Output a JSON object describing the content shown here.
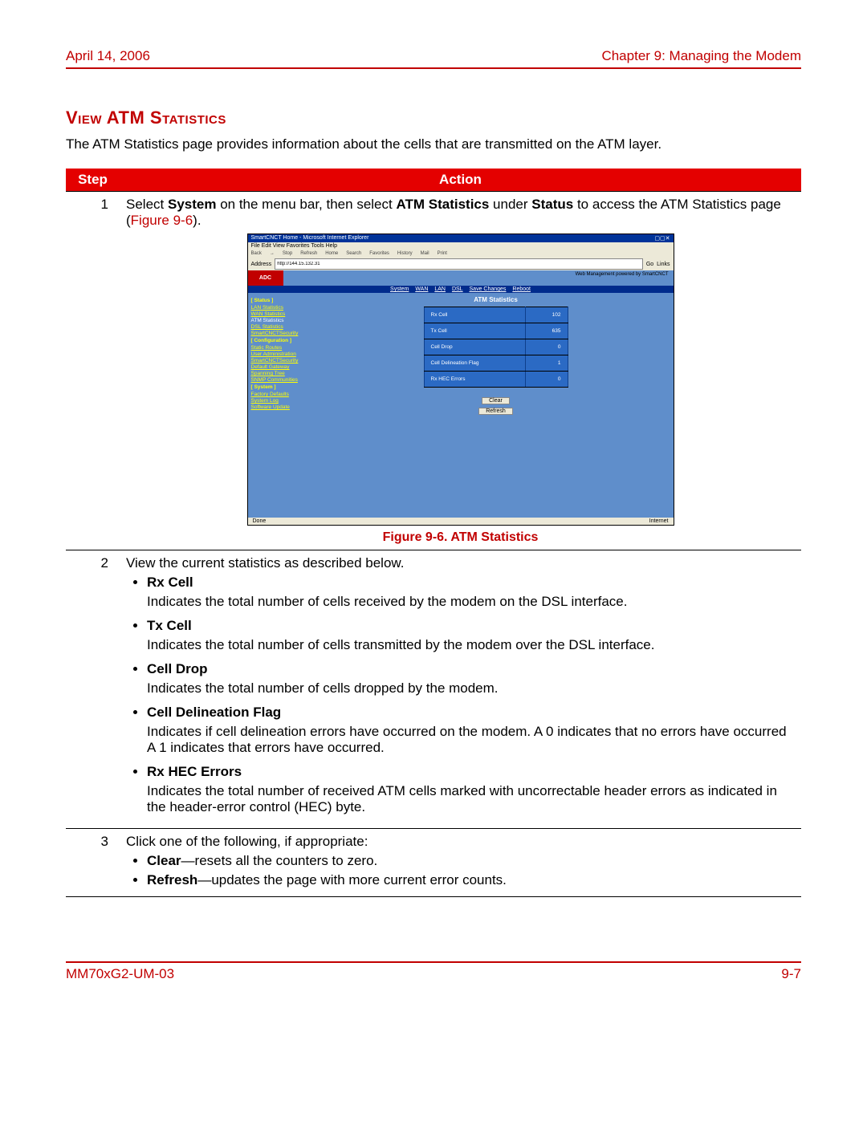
{
  "header": {
    "date": "April 14, 2006",
    "chapter": "Chapter 9: Managing the Modem"
  },
  "section": {
    "title": "View ATM Statistics",
    "intro": "The ATM Statistics page provides information about the cells that are transmitted on the ATM layer."
  },
  "table_head": {
    "step": "Step",
    "action": "Action"
  },
  "step1": {
    "num": "1",
    "a": "Select ",
    "b": "System",
    "c": " on the menu bar, then select ",
    "d": "ATM Statistics",
    "e": " under ",
    "f": "Status",
    "g": " to access the ATM Statistics page (",
    "h": "Figure 9-6",
    "i": ")."
  },
  "figure": {
    "caption": "Figure 9-6. ATM Statistics"
  },
  "screenshot": {
    "window_title": "SmartCNCT Home - Microsoft Internet Explorer",
    "menus": "File  Edit  View  Favorites  Tools  Help",
    "toolbar": [
      "Back",
      "",
      "Stop",
      "Refresh",
      "Home",
      "Search",
      "Favorites",
      "History",
      "Mail",
      "Print"
    ],
    "address_label": "Address",
    "address_value": "http://144.15.132.31",
    "go": "Go",
    "links": "Links",
    "logo": "ADC",
    "web_mgmt": "Web Management powered by SmartCNCT",
    "topnav": [
      "System",
      "WAN",
      "LAN",
      "DSL",
      "Save Changes",
      "Reboot"
    ],
    "sidebar": {
      "status_hdr": "[ Status ]",
      "items1": [
        "LAN Statistics",
        "WAN Statistics",
        "ATM Statistics",
        "DSL Statistics",
        "SmartCNCTSecurity"
      ],
      "config_hdr": "[ Configuration ]",
      "items2": [
        "Static Routes",
        "User Administration",
        "SmartCNCTSecurity",
        "Default Gateway",
        "Spanning Tree",
        "SNMP Communities"
      ],
      "system_hdr": "[ System ]",
      "items3": [
        "Factory Defaults",
        "System Log",
        "Software Update"
      ]
    },
    "main_title": "ATM Statistics",
    "stats": [
      {
        "k": "Rx Cell",
        "v": "102"
      },
      {
        "k": "Tx Cell",
        "v": "635"
      },
      {
        "k": "Cell Drop",
        "v": "0"
      },
      {
        "k": "Cell Delineation Flag",
        "v": "1"
      },
      {
        "k": "Rx HEC Errors",
        "v": "0"
      }
    ],
    "btn_clear": "Clear",
    "btn_refresh": "Refresh",
    "status_left": "Done",
    "status_right": "Internet"
  },
  "step2": {
    "num": "2",
    "lead": "View the current statistics as described below.",
    "items": {
      "rx": {
        "term": "Rx Cell",
        "desc": "Indicates the total number of cells received by the modem on the DSL interface."
      },
      "tx": {
        "term": "Tx Cell",
        "desc": "Indicates the total number of cells transmitted by the modem over the DSL interface."
      },
      "drop": {
        "term": "Cell Drop",
        "desc": "Indicates the total number of cells dropped by the modem."
      },
      "cdf": {
        "term": "Cell Delineation Flag",
        "desc": "Indicates if cell delineation errors have occurred on the modem. A 0 indicates that no errors have occurred A 1 indicates that errors have occurred."
      },
      "hec": {
        "term": "Rx HEC Errors",
        "desc": "Indicates the total number of received ATM cells marked with uncorrectable header errors as indicated in the header-error control (HEC) byte."
      }
    }
  },
  "step3": {
    "num": "3",
    "lead": "Click one of the following, if appropriate:",
    "clear_term": "Clear",
    "clear_desc": "—resets all the counters to zero.",
    "refresh_term": "Refresh",
    "refresh_desc": "—updates the page with more current error counts."
  },
  "footer": {
    "doc": "MM70xG2-UM-03",
    "page": "9-7"
  }
}
